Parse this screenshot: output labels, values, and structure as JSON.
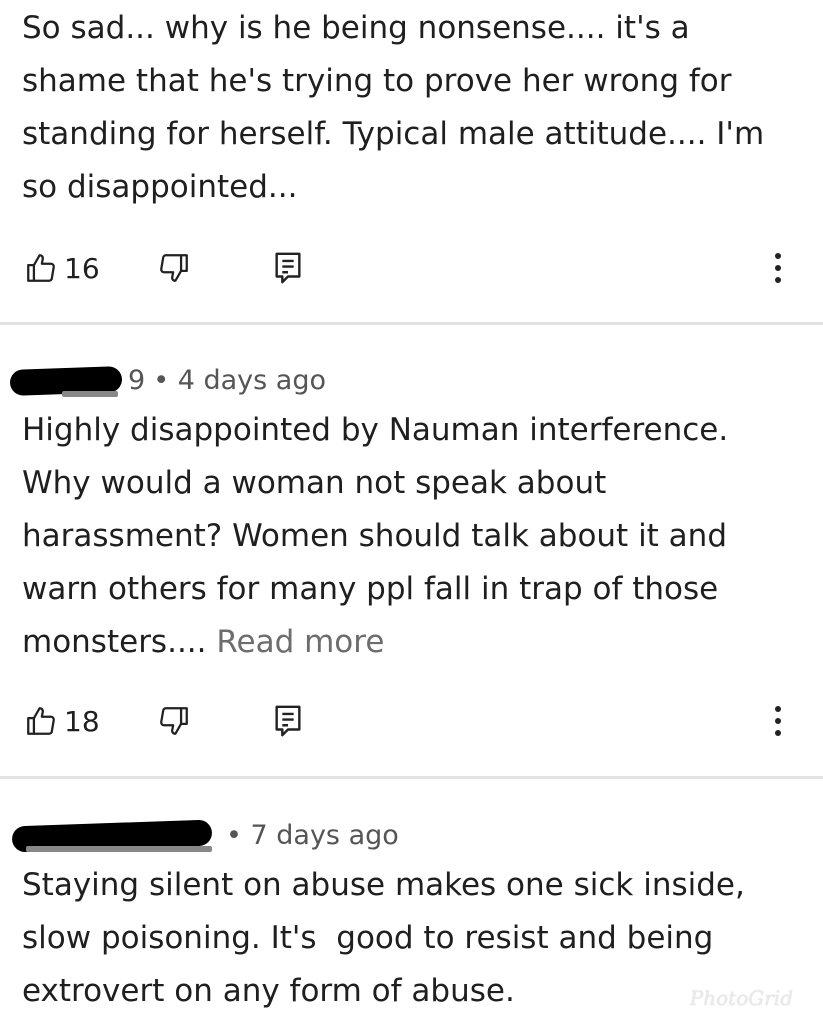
{
  "comments": [
    {
      "author_visible": "",
      "time": "",
      "text": "So sad... why is he being nonsense.... it's a\nshame that he's trying to prove her wrong for\nstanding for herself. Typical male attitude.... I'm\nso disappointed...",
      "read_more": "",
      "likes": "16"
    },
    {
      "author_visible": "9",
      "time": "• 4 days ago",
      "text": "Highly disappointed by Nauman interference.\nWhy would a woman not speak about\nharassment? Women should talk about it and\nwarn others for many ppl fall in trap of those\nmonsters.... ",
      "read_more": "Read more",
      "likes": "18"
    },
    {
      "author_visible": "",
      "time": "• 7 days ago",
      "text": "Staying silent on abuse makes one sick inside,\nslow poisoning. It's  good to resist and being\nextrovert on any form of abuse.",
      "read_more": "",
      "likes": ""
    }
  ],
  "icons": {
    "like": "thumbs-up-icon",
    "dislike": "thumbs-down-icon",
    "reply": "reply-icon",
    "more": "more-vertical-icon"
  },
  "watermark": "PhotoGrid"
}
